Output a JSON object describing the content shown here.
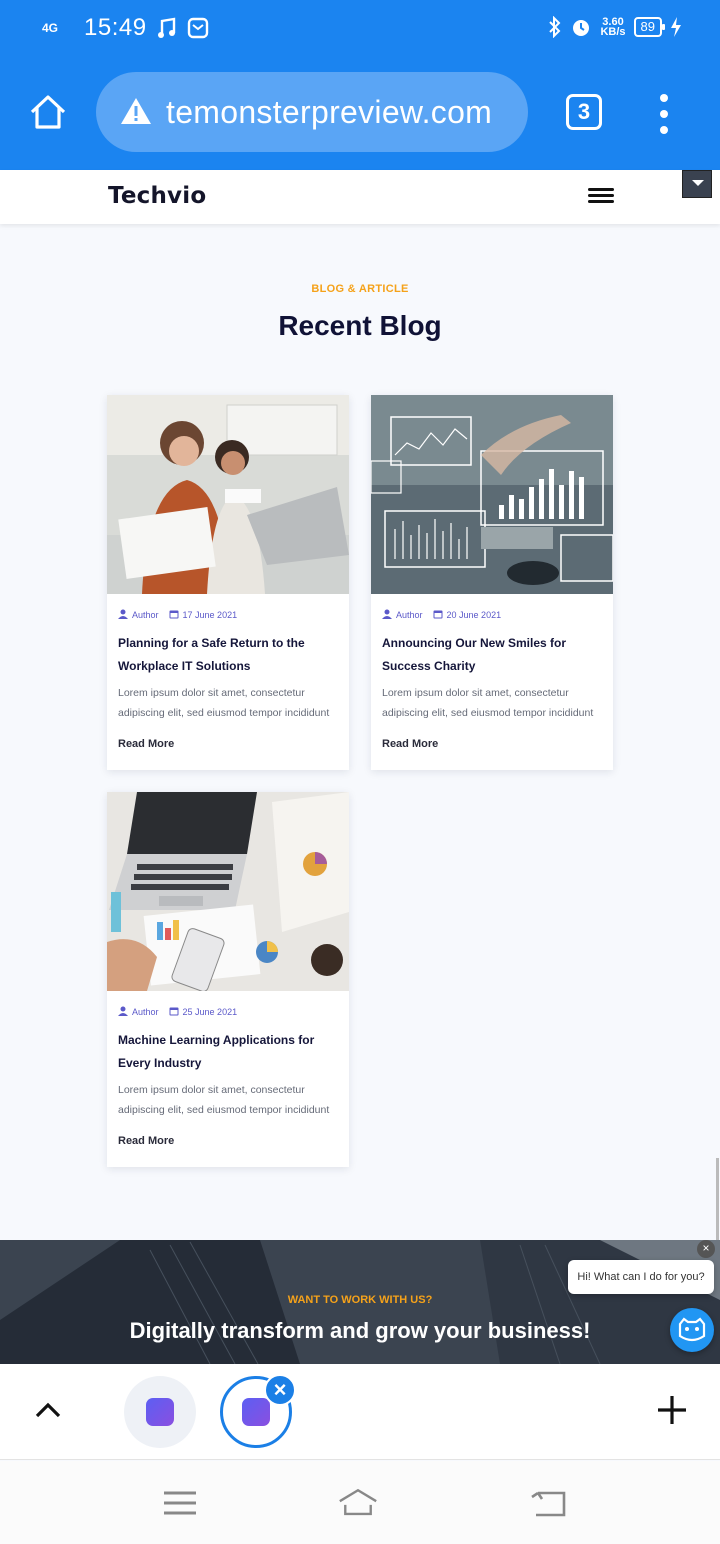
{
  "status_bar": {
    "network": "4G",
    "time": "15:49",
    "speed_value": "3.60",
    "speed_unit": "KB/s",
    "battery": "89"
  },
  "browser": {
    "url": "temonsterpreview.com",
    "tab_count": "3"
  },
  "site": {
    "logo": "Techvio"
  },
  "blog": {
    "eyebrow": "BLOG & ARTICLE",
    "title": "Recent Blog",
    "posts": [
      {
        "author": "Author",
        "date": "17 June 2021",
        "title": "Planning for a Safe Return to the Workplace IT Solutions",
        "excerpt": "Lorem ipsum dolor sit amet, consectetur adipiscing elit, sed eiusmod tempor incididunt",
        "read_more": "Read More"
      },
      {
        "author": "Author",
        "date": "20 June 2021",
        "title": "Announcing Our New Smiles for Success Charity",
        "excerpt": "Lorem ipsum dolor sit amet, consectetur adipiscing elit, sed eiusmod tempor incididunt",
        "read_more": "Read More"
      },
      {
        "author": "Author",
        "date": "25 June 2021",
        "title": "Machine Learning Applications for Every Industry",
        "excerpt": "Lorem ipsum dolor sit amet, consectetur adipiscing elit, sed eiusmod tempor incididunt",
        "read_more": "Read More"
      }
    ]
  },
  "cta": {
    "eyebrow": "WANT TO WORK WITH US?",
    "title": "Digitally transform and grow your business!"
  },
  "chat": {
    "greeting": "Hi! What can I do for you?",
    "close": "×"
  },
  "bottom_bar": {
    "close_tab": "×"
  },
  "colors": {
    "browser_blue": "#1b84f0",
    "accent_orange": "#f5a21a",
    "meta_purple": "#5b59c9",
    "heading_navy": "#101236"
  }
}
